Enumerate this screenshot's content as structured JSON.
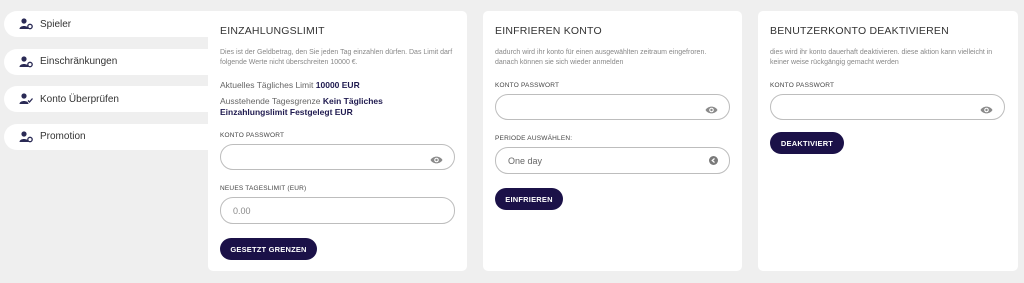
{
  "sidebar": {
    "items": [
      {
        "label": "Spieler",
        "icon": "user-gear-icon"
      },
      {
        "label": "Einschränkungen",
        "icon": "user-gear-icon"
      },
      {
        "label": "Konto Überprüfen",
        "icon": "user-check-icon"
      },
      {
        "label": "Promotion",
        "icon": "user-gear-icon"
      }
    ]
  },
  "deposit": {
    "title": "EINZAHLUNGSLIMIT",
    "desc": "Dies ist der Geldbetrag, den Sie jeden Tag einzahlen dürfen. Das Limit darf folgende Werte nicht überschreiten 10000 €.",
    "current_label": "Aktuelles Tägliches Limit",
    "current_value": "10000 EUR",
    "pending_label": "Ausstehende Tagesgrenze",
    "pending_value": "Kein Tägliches Einzahlungslimit Festgelegt EUR",
    "password_label": "KONTO PASSWORT",
    "password_value": "",
    "new_limit_label": "NEUES TAGESLIMIT (EUR)",
    "new_limit_placeholder": "0.00",
    "button": "GESETZT GRENZEN"
  },
  "freeze": {
    "title": "EINFRIEREN KONTO",
    "desc": "dadurch wird ihr konto für einen ausgewählten zeitraum eingefroren. danach können sie sich wieder anmelden",
    "password_label": "KONTO PASSWORT",
    "password_value": "",
    "period_label": "PERIODE AUSWÄHLEN:",
    "period_value": "One day",
    "button": "EINFRIEREN"
  },
  "deactivate": {
    "title": "BENUTZERKONTO DEAKTIVIEREN",
    "desc": "dies wird ihr konto dauerhaft deaktivieren. diese aktion kann vielleicht in keiner weise rückgängig gemacht werden",
    "password_label": "KONTO PASSWORT",
    "password_value": "",
    "button": "DEAKTIVIERT"
  }
}
